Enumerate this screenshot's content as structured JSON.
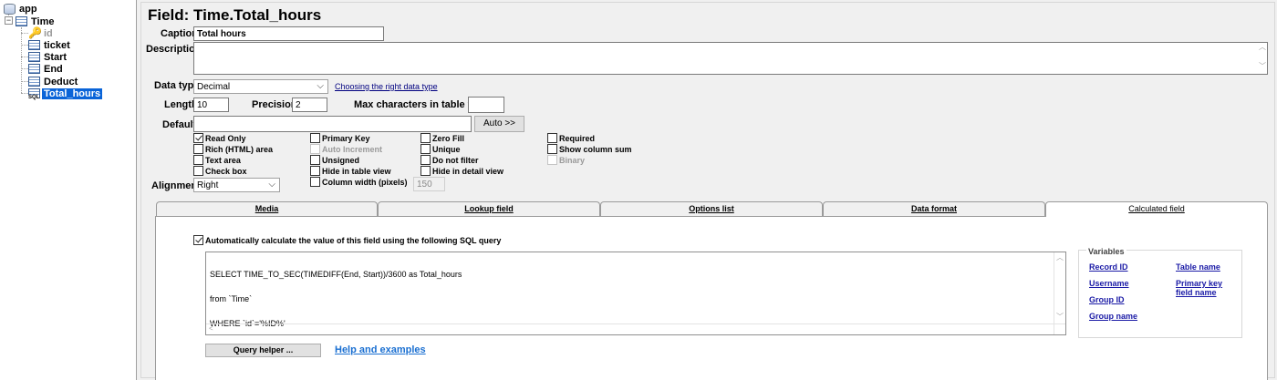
{
  "tree": {
    "root": "app",
    "table": "Time",
    "fields": [
      {
        "label": "id",
        "icon": "key-icon",
        "dimmed": true,
        "selected": false
      },
      {
        "label": "ticket",
        "icon": "field-icon",
        "dimmed": false,
        "selected": false
      },
      {
        "label": "Start",
        "icon": "field-icon",
        "dimmed": false,
        "selected": false
      },
      {
        "label": "End",
        "icon": "field-icon",
        "dimmed": false,
        "selected": false
      },
      {
        "label": "Deduct",
        "icon": "field-icon",
        "dimmed": false,
        "selected": false
      },
      {
        "label": "Total_hours",
        "icon": "sql-field-icon",
        "dimmed": false,
        "selected": true
      }
    ]
  },
  "field": {
    "title": "Field: Time.Total_hours",
    "caption_label": "Caption",
    "caption_value": "Total hours",
    "description_label": "Description",
    "description_value": "",
    "datatype_label": "Data type",
    "datatype_value": "Decimal",
    "datatype_link": "Choosing the right data type",
    "length_label": "Length",
    "length_value": "10",
    "precision_label": "Precision",
    "precision_value": "2",
    "maxchars_label": "Max characters in table view",
    "maxchars_value": "",
    "default_label": "Default",
    "default_value": "",
    "auto_button": "Auto >>",
    "alignment_label": "Alignment",
    "alignment_value": "Right",
    "colwidth_value": "150"
  },
  "checkboxes": {
    "read_only": {
      "label": "Read Only",
      "checked": true
    },
    "rich_html": {
      "label": "Rich (HTML) area",
      "checked": false
    },
    "text_area": {
      "label": "Text area",
      "checked": false
    },
    "check_box": {
      "label": "Check box",
      "checked": false
    },
    "primary_key": {
      "label": "Primary Key",
      "checked": false
    },
    "auto_increment": {
      "label": "Auto Increment",
      "checked": false
    },
    "unsigned": {
      "label": "Unsigned",
      "checked": false
    },
    "hide_table_view": {
      "label": "Hide in table view",
      "checked": false
    },
    "column_width": {
      "label": "Column width (pixels)",
      "checked": false
    },
    "zero_fill": {
      "label": "Zero Fill",
      "checked": false
    },
    "unique": {
      "label": "Unique",
      "checked": false
    },
    "do_not_filter": {
      "label": "Do not filter",
      "checked": false
    },
    "hide_detail_view": {
      "label": "Hide in detail view",
      "checked": false
    },
    "required": {
      "label": "Required",
      "checked": false
    },
    "show_column_sum": {
      "label": "Show column sum",
      "checked": false
    },
    "binary": {
      "label": "Binary",
      "checked": false
    }
  },
  "tabs": [
    {
      "label": "Media",
      "active": false
    },
    {
      "label": "Lookup field",
      "active": false
    },
    {
      "label": "Options list",
      "active": false
    },
    {
      "label": "Data format",
      "active": false
    },
    {
      "label": "Calculated field",
      "active": true
    }
  ],
  "calculated": {
    "auto_calc_label": "Automatically calculate the value of this field using the following SQL query",
    "auto_calc_checked": true,
    "sql_lines": [
      "SELECT TIME_TO_SEC(TIMEDIFF(End, Start))/3600 as Total_hours",
      "from `Time`",
      "WHERE `id`='%ID%'"
    ],
    "query_helper_button": "Query helper ...",
    "help_link": "Help and examples",
    "variables_title": "Variables",
    "variables": {
      "record_id": "Record ID",
      "username": "Username",
      "group_id": "Group ID",
      "group_name": "Group name",
      "table_name": "Table name",
      "primary_key_field_name_1": "Primary key",
      "primary_key_field_name_2": "field name"
    }
  },
  "colors": {
    "selection": "#0a64d8",
    "link": "#1a1aa6",
    "help_link": "#1a6fd1"
  }
}
